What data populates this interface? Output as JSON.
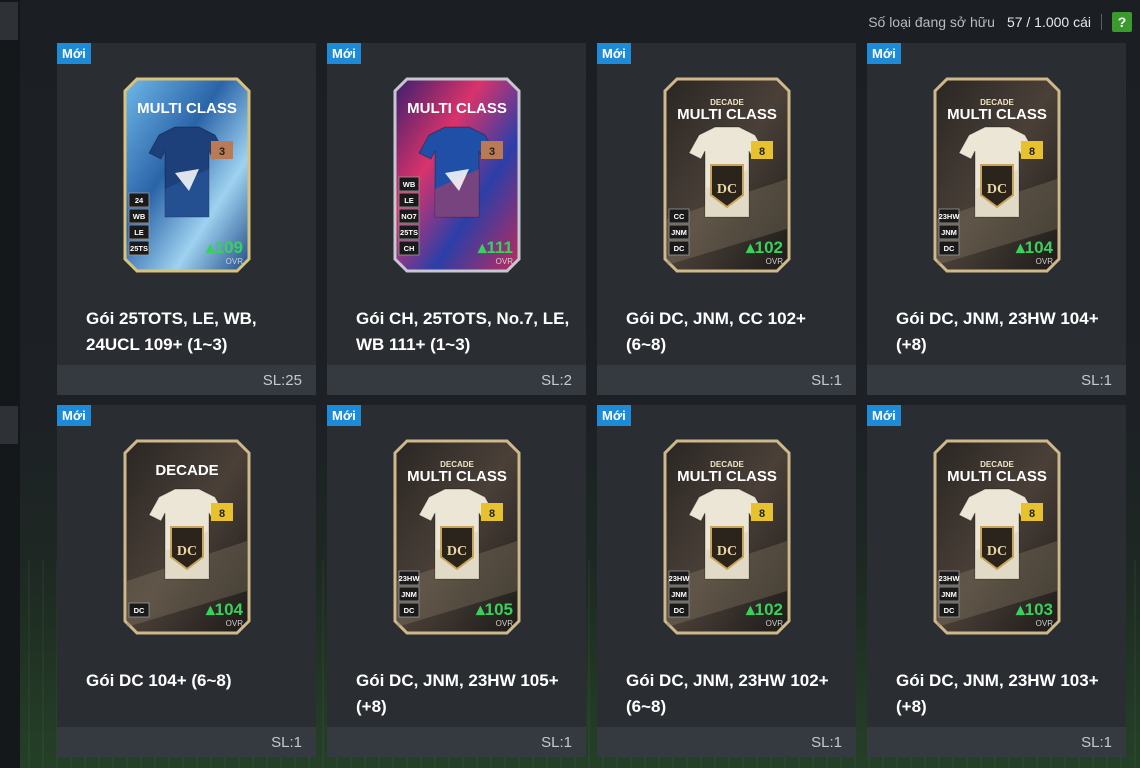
{
  "header": {
    "owned_label": "Số loại đang sở hữu",
    "owned_value": "57 / 1.000 cái",
    "help_label": "?"
  },
  "packs": [
    {
      "badge": "Mới",
      "title": "Gói 25TOTS, LE, WB, 24UCL 109+ (1~3)",
      "qty": "SL:25",
      "card_label": "MULTI CLASS",
      "ovr": "109",
      "ovr_label": "OVR",
      "level": "3",
      "theme": "tots",
      "tags": [
        "24",
        "WB",
        "LE",
        "25TS"
      ]
    },
    {
      "badge": "Mới",
      "title": "Gói CH, 25TOTS, No.7, LE, WB 111+ (1~3)",
      "qty": "SL:2",
      "card_label": "MULTI CLASS",
      "ovr": "111",
      "ovr_label": "OVR",
      "level": "3",
      "theme": "ch",
      "tags": [
        "WB",
        "LE",
        "NO7",
        "25TS",
        "CH"
      ]
    },
    {
      "badge": "Mới",
      "title": "Gói DC, JNM, CC 102+ (6~8)",
      "qty": "SL:1",
      "card_label": "MULTI CLASS",
      "sub_label": "DECADE",
      "ovr": "102",
      "ovr_label": "OVR",
      "level": "8",
      "theme": "dc",
      "tags": [
        "CC",
        "JNM",
        "DC"
      ]
    },
    {
      "badge": "Mới",
      "title": "Gói DC, JNM, 23HW 104+ (+8)",
      "qty": "SL:1",
      "card_label": "MULTI CLASS",
      "sub_label": "DECADE",
      "ovr": "104",
      "ovr_label": "OVR",
      "level": "8",
      "theme": "dc",
      "tags": [
        "23HW",
        "JNM",
        "DC"
      ]
    },
    {
      "badge": "Mới",
      "title": "Gói DC 104+ (6~8)",
      "qty": "SL:1",
      "card_label": "DECADE",
      "ovr": "104",
      "ovr_label": "OVR",
      "level": "8",
      "theme": "dc",
      "tags": [
        "DC"
      ]
    },
    {
      "badge": "Mới",
      "title": "Gói DC, JNM, 23HW 105+ (+8)",
      "qty": "SL:1",
      "card_label": "MULTI CLASS",
      "sub_label": "DECADE",
      "ovr": "105",
      "ovr_label": "OVR",
      "level": "8",
      "theme": "dc",
      "tags": [
        "23HW",
        "JNM",
        "DC"
      ]
    },
    {
      "badge": "Mới",
      "title": "Gói DC, JNM, 23HW 102+ (6~8)",
      "qty": "SL:1",
      "card_label": "MULTI CLASS",
      "sub_label": "DECADE",
      "ovr": "102",
      "ovr_label": "OVR",
      "level": "8",
      "theme": "dc",
      "tags": [
        "23HW",
        "JNM",
        "DC"
      ]
    },
    {
      "badge": "Mới",
      "title": "Gói DC, JNM, 23HW 103+ (+8)",
      "qty": "SL:1",
      "card_label": "MULTI CLASS",
      "sub_label": "DECADE",
      "ovr": "103",
      "ovr_label": "OVR",
      "level": "8",
      "theme": "dc",
      "tags": [
        "23HW",
        "JNM",
        "DC"
      ]
    }
  ],
  "colors": {
    "new_badge": "#1e8bd8",
    "ovr_green": "#39d05c",
    "help_green": "#3b9a2e",
    "gold": "#c9a45a"
  }
}
